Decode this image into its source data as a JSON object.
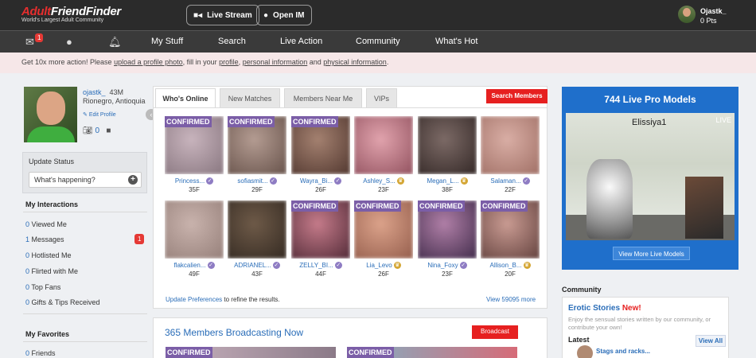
{
  "header": {
    "logo_part1": "Adult",
    "logo_part2": "FriendFinder",
    "logo_tagline": "World's Largest Adult Community",
    "live_stream_label": "Live Stream",
    "open_im_label": "Open IM",
    "username": "Ojastk_",
    "points": "0 Pts"
  },
  "nav": {
    "mail_badge": "1",
    "links": [
      "My Stuff",
      "Search",
      "Live Action",
      "Community",
      "What's Hot"
    ]
  },
  "banner": {
    "prefix": "Get 10x more action! Please ",
    "link1": "upload a profile photo",
    "mid1": ", fill in your ",
    "link2": "profile",
    "mid2": ", ",
    "link3": "personal information",
    "mid3": " and ",
    "link4": "physical information",
    "suffix": "."
  },
  "profile": {
    "username": "ojastk_",
    "age_sex": "43M",
    "location": "Rionegro, Antioquia",
    "edit_label": "Edit Profile",
    "photo_count": "0"
  },
  "status": {
    "label": "Update Status",
    "placeholder": "What's happening?"
  },
  "interactions": {
    "title": "My Interactions",
    "items": [
      {
        "count": "0",
        "label": "Viewed Me"
      },
      {
        "count": "1",
        "label": "Messages",
        "badge": "1"
      },
      {
        "count": "0",
        "label": "Hotlisted Me"
      },
      {
        "count": "0",
        "label": "Flirted with Me"
      },
      {
        "count": "0",
        "label": "Top Fans"
      },
      {
        "count": "0",
        "label": "Gifts & Tips Received"
      }
    ]
  },
  "favorites": {
    "title": "My Favorites",
    "items": [
      {
        "count": "0",
        "label": "Friends"
      }
    ]
  },
  "tabs": [
    "Who's Online",
    "New Matches",
    "Members Near Me",
    "VIPs"
  ],
  "search_members_label": "Search Members",
  "confirmed_label": "CONFIRMED",
  "members": [
    {
      "name": "Princess...",
      "age": "35F",
      "confirmed": true,
      "colors": [
        "#c8b4bd",
        "#8f7d86"
      ]
    },
    {
      "name": "sofiasmit...",
      "age": "29F",
      "confirmed": true,
      "colors": [
        "#b49c92",
        "#6f5a52"
      ]
    },
    {
      "name": "Wayra_Bi...",
      "age": "26F",
      "confirmed": true,
      "colors": [
        "#a48170",
        "#5a3f36"
      ]
    },
    {
      "name": "Ashley_S...",
      "age": "23F",
      "confirmed": false,
      "gold": true,
      "colors": [
        "#e1a3ad",
        "#9a5a67"
      ]
    },
    {
      "name": "Megan_L...",
      "age": "38F",
      "confirmed": false,
      "gold": true,
      "colors": [
        "#7c6a66",
        "#3b2f2d"
      ]
    },
    {
      "name": "Salaman...",
      "age": "22F",
      "confirmed": false,
      "colors": [
        "#d9aea5",
        "#a6766c"
      ]
    },
    {
      "name": "flakcalien...",
      "age": "49F",
      "confirmed": false,
      "colors": [
        "#c9b3ad",
        "#9b857f"
      ]
    },
    {
      "name": "ADRIANEL...",
      "age": "43F",
      "confirmed": false,
      "colors": [
        "#6e5a48",
        "#3a2f26"
      ]
    },
    {
      "name": "ZELLY_BI...",
      "age": "44F",
      "confirmed": true,
      "colors": [
        "#c57b8a",
        "#5e3340"
      ]
    },
    {
      "name": "Lia_Levo",
      "age": "26F",
      "confirmed": true,
      "gold": true,
      "colors": [
        "#dba28a",
        "#9c6553"
      ]
    },
    {
      "name": "Nina_Foxy",
      "age": "23F",
      "confirmed": true,
      "colors": [
        "#b07fa7",
        "#4d3555"
      ]
    },
    {
      "name": "Allison_B...",
      "age": "20F",
      "confirmed": true,
      "gold": true,
      "colors": [
        "#c99b92",
        "#6e4b47"
      ]
    }
  ],
  "update_prefs": {
    "link": "Update Preferences",
    "rest": " to refine the results."
  },
  "view_more": "View 59095 more",
  "broadcast": {
    "title": "365 Members Broadcasting Now",
    "button": "Broadcast"
  },
  "live_models": {
    "title": "744 Live Pro Models",
    "model_name": "Elissiya1",
    "live_tag": "LIVE",
    "more_label": "View More Live Models"
  },
  "community": {
    "title": "Community",
    "story_heading": "Erotic Stories",
    "story_new": "New!",
    "story_desc": "Enjoy the sensual stories written by our community, or contribute your own!",
    "latest_label": "Latest",
    "view_all": "View All",
    "story_title": "Stags and racks..."
  }
}
